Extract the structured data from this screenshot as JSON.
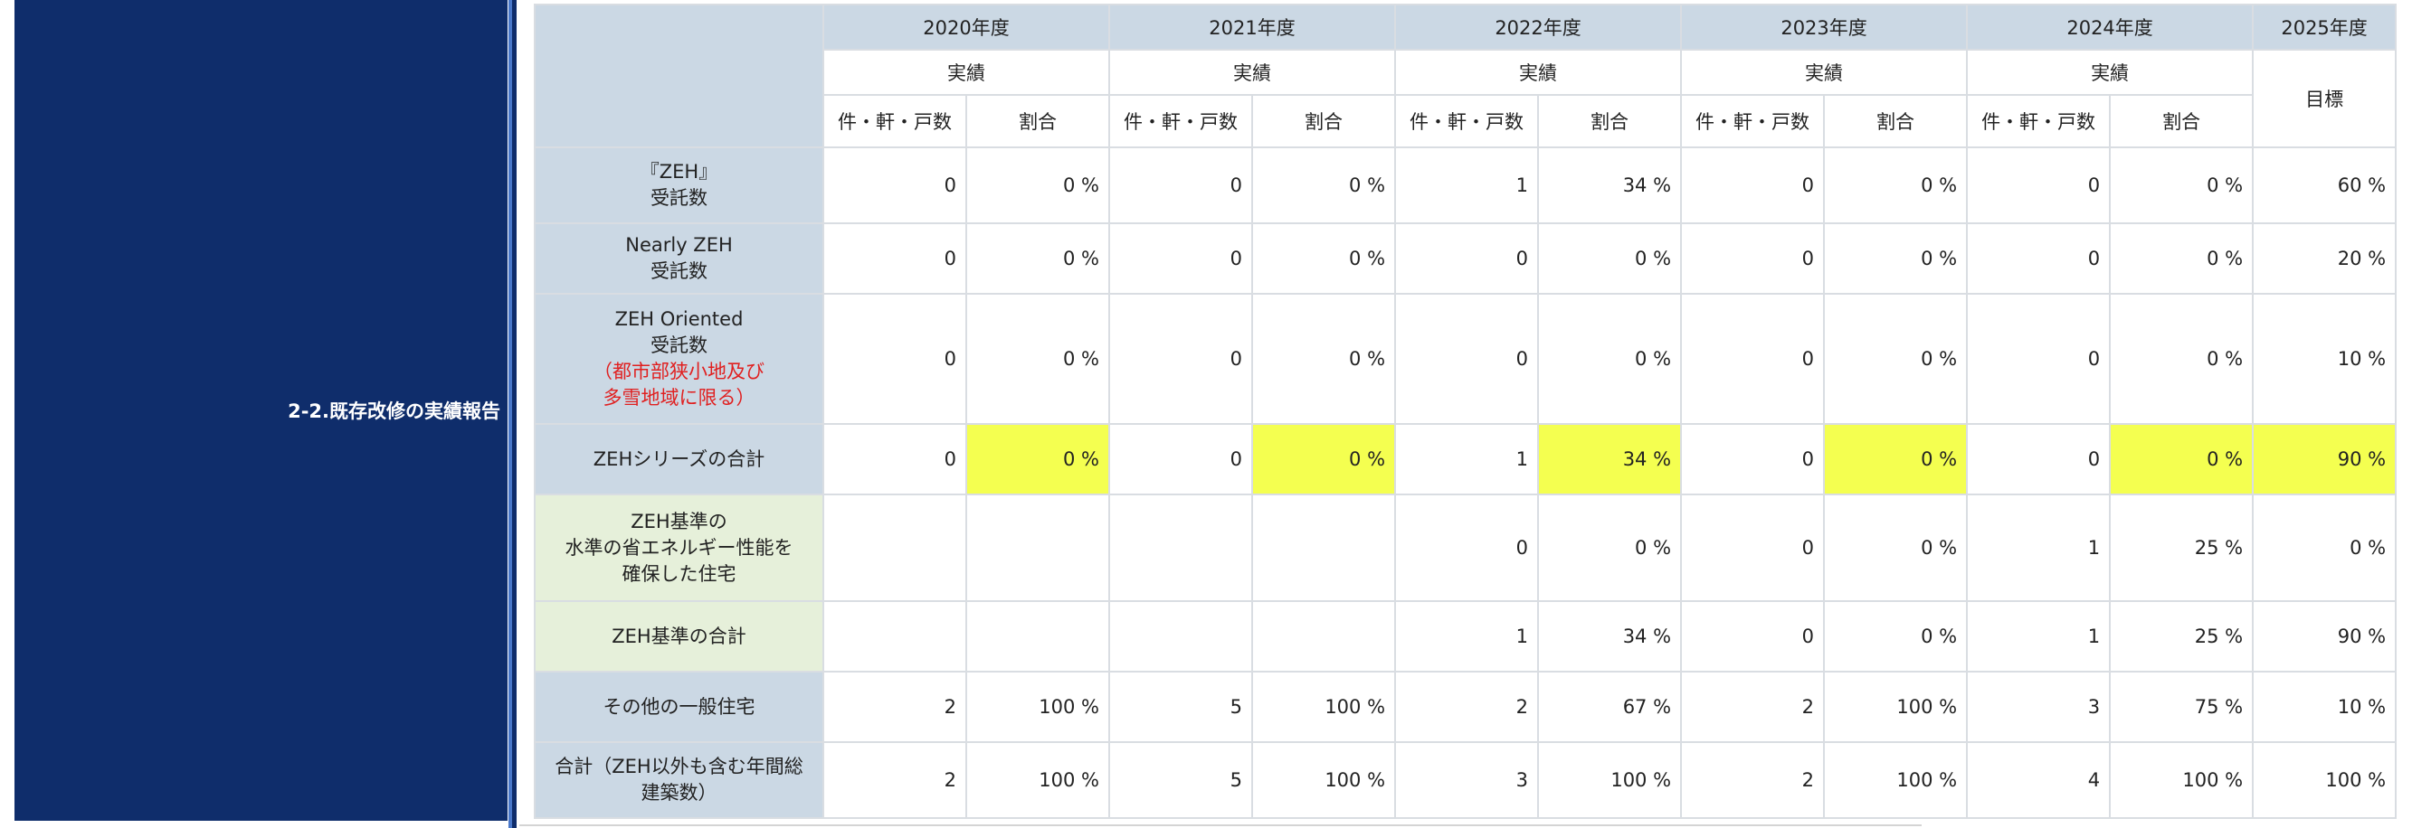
{
  "sidebar": {
    "section_title": "2-2.既存改修の実績報告"
  },
  "table": {
    "years": [
      "2020年度",
      "2021年度",
      "2022年度",
      "2023年度",
      "2024年度",
      "2025年度"
    ],
    "result_label": "実績",
    "target_label": "目標",
    "count_label": "件・軒・戸数",
    "ratio_label": "割合",
    "rows": [
      {
        "label_lines": [
          "『ZEH』",
          "受託数"
        ],
        "values": [
          "0",
          "0 %",
          "0",
          "0 %",
          "1",
          "34 %",
          "0",
          "0 %",
          "0",
          "0 %",
          "60 %"
        ]
      },
      {
        "label_lines": [
          "Nearly ZEH",
          "受託数"
        ],
        "values": [
          "0",
          "0 %",
          "0",
          "0 %",
          "0",
          "0 %",
          "0",
          "0 %",
          "0",
          "0 %",
          "20 %"
        ]
      },
      {
        "label_lines": [
          "ZEH Oriented",
          "受託数"
        ],
        "note_lines": [
          "（都市部狭小地及び",
          "多雪地域に限る）"
        ],
        "values": [
          "0",
          "0 %",
          "0",
          "0 %",
          "0",
          "0 %",
          "0",
          "0 %",
          "0",
          "0 %",
          "10 %"
        ]
      },
      {
        "label_lines": [
          "ZEHシリーズの合計"
        ],
        "values": [
          "0",
          "0 %",
          "0",
          "0 %",
          "1",
          "34 %",
          "0",
          "0 %",
          "0",
          "0 %",
          "90 %"
        ]
      },
      {
        "label_lines": [
          "ZEH基準の",
          "水準の省エネルギー性能を",
          "確保した住宅"
        ],
        "values": [
          "",
          "",
          "",
          "",
          "0",
          "0 %",
          "0",
          "0 %",
          "1",
          "25 %",
          "0 %"
        ]
      },
      {
        "label_lines": [
          "ZEH基準の合計"
        ],
        "values": [
          "",
          "",
          "",
          "",
          "1",
          "34 %",
          "0",
          "0 %",
          "1",
          "25 %",
          "90 %"
        ]
      },
      {
        "label_lines": [
          "その他の一般住宅"
        ],
        "values": [
          "2",
          "100 %",
          "5",
          "100 %",
          "2",
          "67 %",
          "2",
          "100 %",
          "3",
          "75 %",
          "10 %"
        ]
      },
      {
        "label_lines": [
          "合計（ZEH以外も含む年間総",
          "建築数）"
        ],
        "values": [
          "2",
          "100 %",
          "5",
          "100 %",
          "3",
          "100 %",
          "2",
          "100 %",
          "4",
          "100 %",
          "100 %"
        ]
      }
    ]
  }
}
